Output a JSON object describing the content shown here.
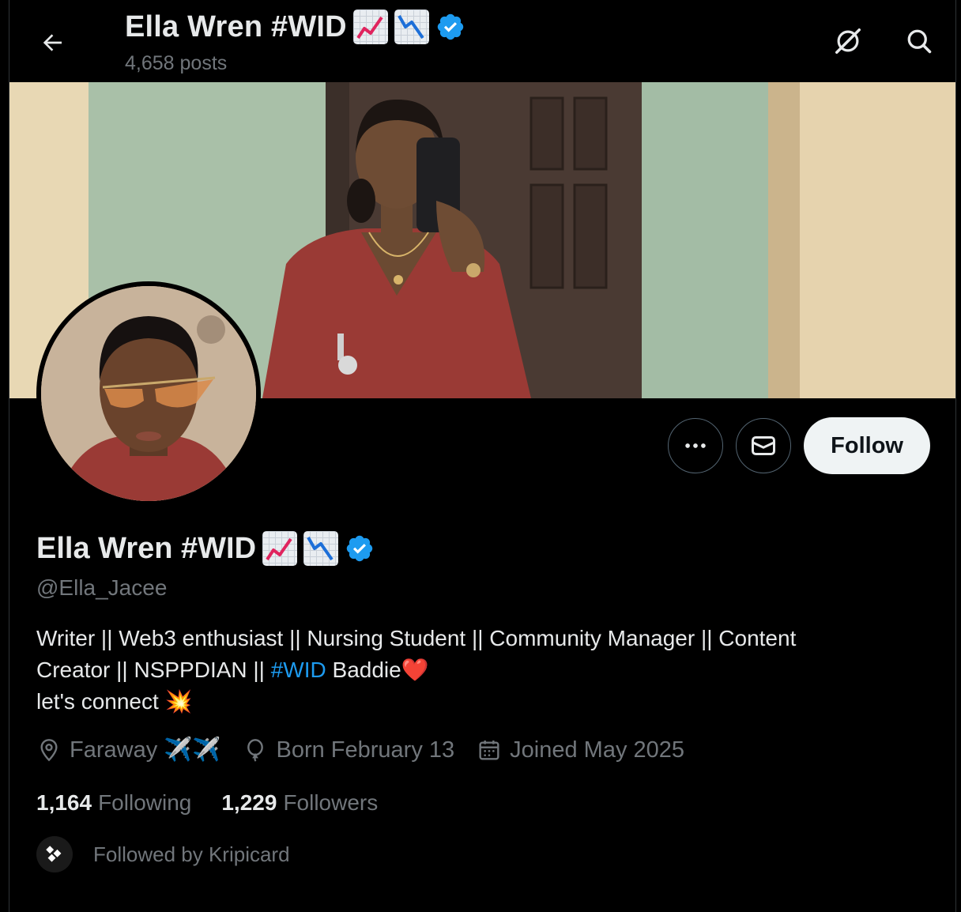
{
  "header": {
    "display_name": "Ella Wren #WID",
    "posts_count": "4,658 posts",
    "back_icon": "arrow-left-icon",
    "grok_icon": "grok-icon",
    "search_icon": "search-icon"
  },
  "profile": {
    "display_name": "Ella Wren #WID",
    "handle": "@Ella_Jacee",
    "verified": true,
    "bio_line1_pre": "Writer || Web3 enthusiast || Nursing Student || Community Manager || Content",
    "bio_line2_pre": "Creator || NSPPDIAN || ",
    "bio_hashtag": "#WID",
    "bio_line2_post": " Baddie",
    "bio_line2_emoji": "❤️",
    "bio_line3": "let's connect ",
    "bio_line3_emoji": "💥",
    "location": "Faraway ✈️✈️",
    "birthday": "Born February 13",
    "joined": "Joined May 2025",
    "following_count": "1,164",
    "following_label": "Following",
    "followers_count": "1,229",
    "followers_label": "Followers",
    "followed_by": "Followed by Kripicard"
  },
  "actions": {
    "more_icon": "more-icon",
    "message_icon": "envelope-icon",
    "follow_label": "Follow"
  },
  "colors": {
    "accent": "#1d9bf0",
    "background": "#000000",
    "muted": "#71767b",
    "follow_bg": "#eff3f4"
  }
}
